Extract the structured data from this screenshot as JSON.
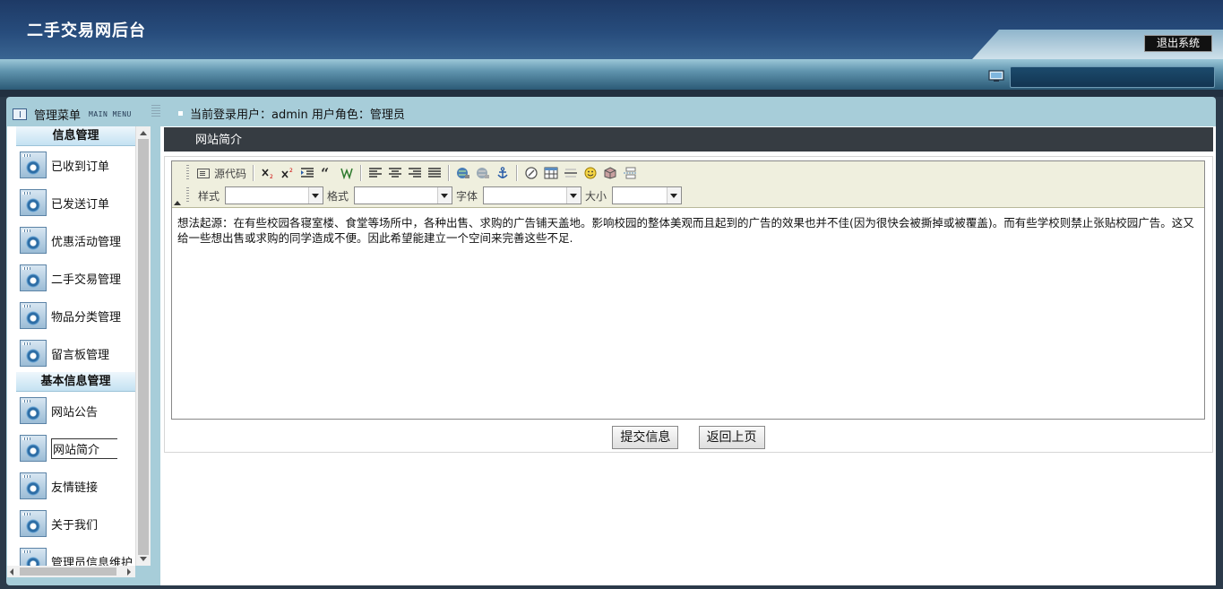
{
  "app": {
    "title": "二手交易网后台",
    "logout_label": "退出系统"
  },
  "menu": {
    "title": "管理菜单",
    "title_en": "MAIN MENU"
  },
  "user_bar": {
    "text": "当前登录用户：admin  用户角色：管理员"
  },
  "sidebar": {
    "sections": [
      {
        "title": "信息管理",
        "items": [
          "已收到订单",
          "已发送订单",
          "优惠活动管理",
          "二手交易管理",
          "物品分类管理",
          "留言板管理"
        ]
      },
      {
        "title": "基本信息管理",
        "items": [
          "网站公告",
          "网站简介",
          "友情链接",
          "关于我们",
          "管理员信息维护"
        ]
      }
    ],
    "selected": "网站简介"
  },
  "content": {
    "header": "网站简介"
  },
  "editor": {
    "source_label": "源代码",
    "style_label": "样式",
    "format_label": "格式",
    "font_label": "字体",
    "size_label": "大小",
    "text": "想法起源：在有些校园各寝室楼、食堂等场所中，各种出售、求购的广告铺天盖地。影响校园的整体美观而且起到的广告的效果也并不佳(因为很快会被撕掉或被覆盖)。而有些学校则禁止张贴校园广告。这又给一些想出售或求购的同学造成不便。因此希望能建立一个空间来完善这些不足."
  },
  "buttons": {
    "submit": "提交信息",
    "back": "返回上页"
  },
  "icons": [
    "monitor-icon",
    "menu-icon",
    "gear-icon",
    "source-icon",
    "subscript-icon",
    "superscript-icon",
    "indent-icon",
    "blockquote-icon",
    "div-icon",
    "align-left-icon",
    "align-center-icon",
    "align-right-icon",
    "justify-icon",
    "link-icon",
    "unlink-icon",
    "anchor-icon",
    "flash-icon",
    "table-icon",
    "horizontal-rule-icon",
    "smiley-icon",
    "special-char-icon",
    "page-break-icon"
  ],
  "colors": {
    "header_bg": "#1e3a66",
    "frame_bg": "#a7cdd9",
    "content_header_bg": "#363c42",
    "toolbar_bg": "#efefde"
  }
}
